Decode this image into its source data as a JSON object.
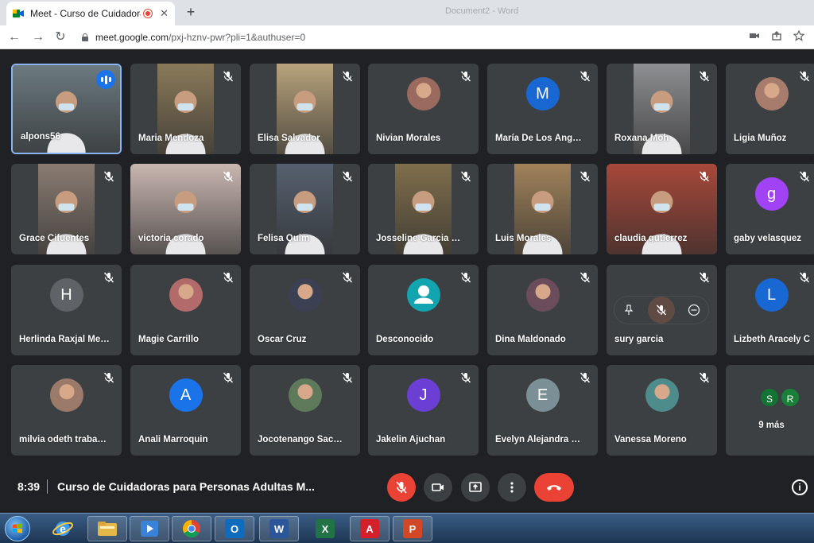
{
  "browser": {
    "tab_title": "Meet - Curso de Cuidadoras",
    "tab_close": "✕",
    "new_tab": "+",
    "ghost_tab": "Document2 - Word",
    "url_host": "meet.google.com",
    "url_path": "/pxj-hznv-pwr?pli=1&authuser=0",
    "back": "←",
    "forward": "→",
    "reload": "↻"
  },
  "participants": [
    {
      "name": "alpons56",
      "type": "video",
      "bg": "#6b7a80",
      "speaking": true
    },
    {
      "name": "Maria Mendoza",
      "type": "video",
      "bg": "#8a7a5a"
    },
    {
      "name": "Elisa Salvador",
      "type": "video",
      "bg": "#b8a37c"
    },
    {
      "name": "Nivian Morales",
      "type": "photo",
      "bg": "#9a6a5e"
    },
    {
      "name": "María De Los Áng…",
      "type": "letter",
      "letter": "M",
      "color": "#1967d2"
    },
    {
      "name": "Roxana Moh",
      "type": "video",
      "bg": "#8e8f92"
    },
    {
      "name": "Ligia Muñoz",
      "type": "photo",
      "bg": "#a87c6c"
    },
    {
      "name": "Grace Cifuentes",
      "type": "video",
      "bg": "#8a7c72"
    },
    {
      "name": "victoria corado",
      "type": "video",
      "bg": "#c9b6b0"
    },
    {
      "name": "Felisa Quim",
      "type": "video",
      "bg": "#55606e"
    },
    {
      "name": "Josseline Garcia …",
      "type": "video",
      "bg": "#7f6e4c"
    },
    {
      "name": "Luis Morales",
      "type": "video",
      "bg": "#a1825a"
    },
    {
      "name": "claudia gutierrez",
      "type": "video",
      "bg": "#a8483a"
    },
    {
      "name": "gaby velasquez",
      "type": "letter",
      "letter": "g",
      "color": "#a142f4"
    },
    {
      "name": "Herlinda Raxjal Me…",
      "type": "letter",
      "letter": "H",
      "color": "#5f6368"
    },
    {
      "name": "Magie Carrillo",
      "type": "photo",
      "bg": "#b26a6a"
    },
    {
      "name": "Oscar Cruz",
      "type": "photo",
      "bg": "#3b4152"
    },
    {
      "name": "Desconocido",
      "type": "anon",
      "color": "#12a4af"
    },
    {
      "name": "Dina Maldonado",
      "type": "photo",
      "bg": "#6a4c5a"
    },
    {
      "name": "sury garcia",
      "type": "hover"
    },
    {
      "name": "Lizbeth Aracely C",
      "type": "letter",
      "letter": "L",
      "color": "#1967d2"
    },
    {
      "name": "milvia odeth traba…",
      "type": "photo",
      "bg": "#9c7a6a"
    },
    {
      "name": "Anali Marroquin",
      "type": "letter",
      "letter": "A",
      "color": "#1a73e8"
    },
    {
      "name": "Jocotenango Sac…",
      "type": "photo",
      "bg": "#5e7a5a"
    },
    {
      "name": "Jakelin Ajuchan",
      "type": "letter",
      "letter": "J",
      "color": "#6b3fd4"
    },
    {
      "name": "Evelyn Alejandra …",
      "type": "letter",
      "letter": "E",
      "color": "#7b8f96"
    },
    {
      "name": "Vanessa Moreno",
      "type": "photo",
      "bg": "#4d8c8a"
    },
    {
      "name": "9 más",
      "type": "more",
      "mini": [
        {
          "letter": "S",
          "color": "#137333"
        },
        {
          "letter": "R",
          "color": "#188038"
        }
      ]
    }
  ],
  "meeting": {
    "time": "8:39",
    "title": "Curso de Cuidadoras para Personas Adultas M...",
    "info": "i"
  },
  "taskbar": {
    "apps": [
      "windows-explorer",
      "internet-explorer",
      "file-explorer",
      "media-player",
      "chrome",
      "outlook",
      "word",
      "excel",
      "acrobat",
      "powerpoint"
    ]
  }
}
